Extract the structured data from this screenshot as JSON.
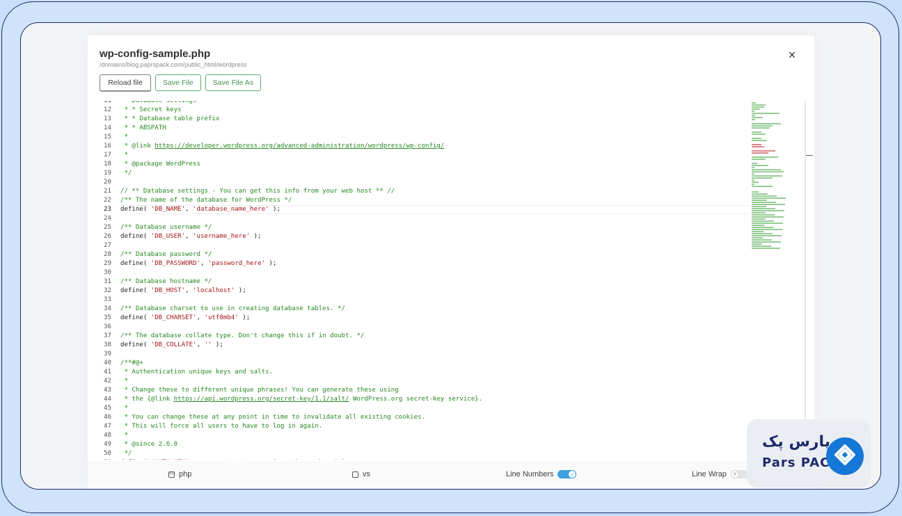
{
  "dialog": {
    "title": "wp-config-sample.php",
    "path": "/domains/blog.paprspack.com/public_html/wordpress",
    "close_label": "×"
  },
  "toolbar": {
    "reload_label": "Reload file",
    "save_label": "Save File",
    "save_as_label": "Save File As"
  },
  "editor": {
    "first_line_partial": " * Database settings",
    "active_line": 23,
    "lines": [
      {
        "n": 12,
        "html": "<span class='c'> * * Secret keys</span>"
      },
      {
        "n": 13,
        "html": "<span class='c'> * * Database table prefix</span>"
      },
      {
        "n": 14,
        "html": "<span class='c'> * * ABSPATH</span>"
      },
      {
        "n": 15,
        "html": "<span class='c'> *</span>"
      },
      {
        "n": 16,
        "html": "<span class='c'> * @link </span><span class='u'>https://developer.wordpress.org/advanced-administration/wordpress/wp-config/</span>"
      },
      {
        "n": 17,
        "html": "<span class='c'> *</span>"
      },
      {
        "n": 18,
        "html": "<span class='c'> * @package WordPress</span>"
      },
      {
        "n": 19,
        "html": "<span class='c'> */</span>"
      },
      {
        "n": 20,
        "html": ""
      },
      {
        "n": 21,
        "html": "<span class='c'>// ** Database settings - You can get this info from your web host ** //</span>"
      },
      {
        "n": 22,
        "html": "<span class='c'>/** The name of the database for WordPress */</span>"
      },
      {
        "n": 23,
        "html": "define( <span class='s'>'DB_NAME'</span>, <span class='s'>'database_name_here'</span> );"
      },
      {
        "n": 24,
        "html": ""
      },
      {
        "n": 25,
        "html": "<span class='c'>/** Database username */</span>"
      },
      {
        "n": 26,
        "html": "define( <span class='s'>'DB_USER'</span>, <span class='s'>'username_here'</span> );"
      },
      {
        "n": 27,
        "html": ""
      },
      {
        "n": 28,
        "html": "<span class='c'>/** Database password */</span>"
      },
      {
        "n": 29,
        "html": "define( <span class='s'>'DB_PASSWORD'</span>, <span class='s'>'password_here'</span> );"
      },
      {
        "n": 30,
        "html": ""
      },
      {
        "n": 31,
        "html": "<span class='c'>/** Database hostname */</span>"
      },
      {
        "n": 32,
        "html": "define( <span class='s'>'DB_HOST'</span>, <span class='s'>'localhost'</span> );"
      },
      {
        "n": 33,
        "html": ""
      },
      {
        "n": 34,
        "html": "<span class='c'>/** Database charset to use in creating database tables. */</span>"
      },
      {
        "n": 35,
        "html": "define( <span class='s'>'DB_CHARSET'</span>, <span class='s'>'utf8mb4'</span> );"
      },
      {
        "n": 36,
        "html": ""
      },
      {
        "n": 37,
        "html": "<span class='c'>/** The database collate type. Don't change this if in doubt. */</span>"
      },
      {
        "n": 38,
        "html": "define( <span class='s'>'DB_COLLATE'</span>, <span class='s'>''</span> );"
      },
      {
        "n": 39,
        "html": ""
      },
      {
        "n": 40,
        "html": "<span class='c'>/**#@+</span>"
      },
      {
        "n": 41,
        "html": "<span class='c'> * Authentication unique keys and salts.</span>"
      },
      {
        "n": 42,
        "html": "<span class='c'> *</span>"
      },
      {
        "n": 43,
        "html": "<span class='c'> * Change these to different unique phrases! You can generate these using</span>"
      },
      {
        "n": 44,
        "html": "<span class='c'> * the {@link </span><span class='u'>https://api.wordpress.org/secret-key/1.1/salt/</span><span class='c'> WordPress.org secret-key service}.</span>"
      },
      {
        "n": 45,
        "html": "<span class='c'> *</span>"
      },
      {
        "n": 46,
        "html": "<span class='c'> * You can change these at any point in time to invalidate all existing cookies.</span>"
      },
      {
        "n": 47,
        "html": "<span class='c'> * This will force all users to have to log in again.</span>"
      },
      {
        "n": 48,
        "html": "<span class='c'> *</span>"
      },
      {
        "n": 49,
        "html": "<span class='c'> * @since 2.6.0</span>"
      },
      {
        "n": 50,
        "html": "<span class='c'> */</span>"
      },
      {
        "n": 51,
        "html": "define( <span class='s'>'AUTH_KEY'</span>,         <span class='s'>'put your unique phrase here'</span> );"
      }
    ]
  },
  "footer": {
    "language_label": "php",
    "theme_label": "vs",
    "line_numbers_label": "Line Numbers",
    "line_numbers_on": true,
    "line_wrap_label": "Line Wrap",
    "line_wrap_on": false
  },
  "logo": {
    "fa_text": "پارس پک",
    "en_text": "Pars PACK"
  },
  "colors": {
    "accent": "#3aa0e0",
    "button_green": "#5cae6a",
    "comment": "#26881f",
    "string": "#a31515",
    "brand": "#1f2a6b"
  }
}
